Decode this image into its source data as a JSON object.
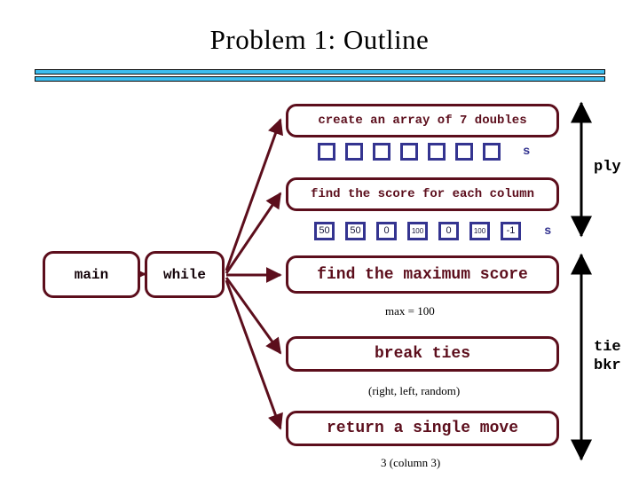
{
  "slide": {
    "title": "Problem 1:  Outline",
    "accent_bar_color": "#3cbdf0",
    "box_border_color": "#5c0e1c",
    "cell_border_color": "#343490"
  },
  "flow": {
    "main_label": "main",
    "while_label": "while",
    "steps": [
      {
        "label": "create an array of 7 doubles"
      },
      {
        "label": "find the score for each column"
      },
      {
        "label": "find the maximum score"
      },
      {
        "label": "break ties"
      },
      {
        "label": "return a single move"
      }
    ]
  },
  "arrays": {
    "empty": {
      "cells": [
        "",
        "",
        "",
        "",
        "",
        "",
        ""
      ],
      "tail_label": "s"
    },
    "values": {
      "cells": [
        "50",
        "50",
        "0",
        "100",
        "0",
        "100",
        "-1"
      ],
      "tail_label": "s"
    }
  },
  "captions": {
    "max": "max = 100",
    "tie_break": "(right, left, random)",
    "result": "3  (column 3)"
  },
  "side_annotations": [
    {
      "name": "ply",
      "label": "ply"
    },
    {
      "name": "tie-breaker",
      "label_line1": "tie",
      "label_line2": "bkr"
    }
  ]
}
